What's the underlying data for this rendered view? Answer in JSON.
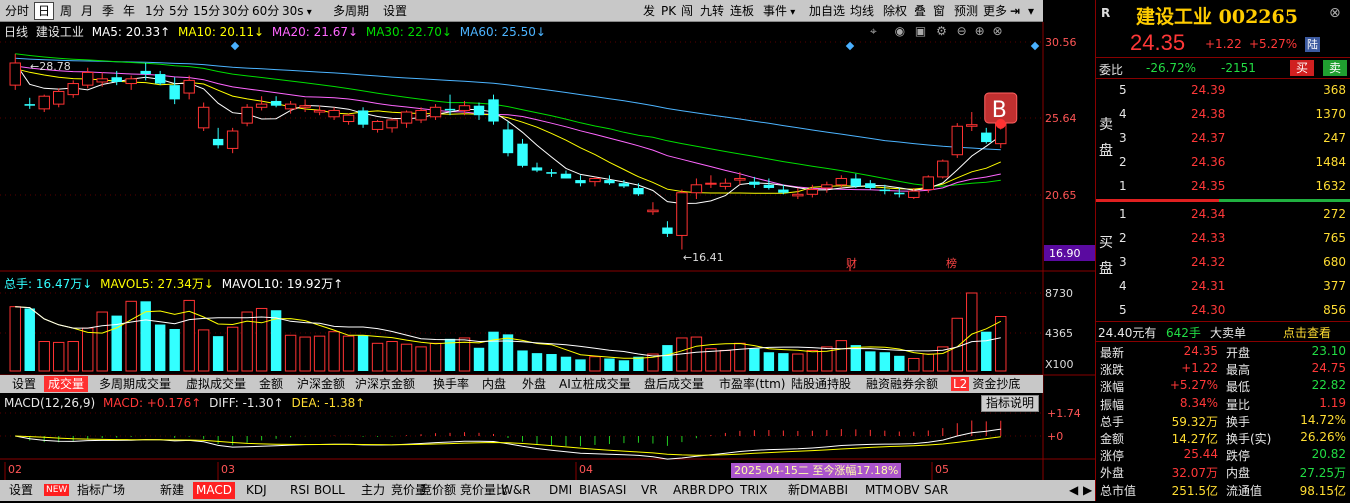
{
  "toolbar": {
    "items": [
      "分时",
      "日",
      "周",
      "月",
      "季",
      "年",
      "1分",
      "5分",
      "15分",
      "30分",
      "60分",
      "30s",
      "多周期",
      "设置"
    ],
    "right": [
      "发",
      "PK",
      "闯",
      "九转",
      "连板",
      "事件",
      "加自选",
      "均线",
      "除权",
      "叠",
      "窗",
      "预测",
      "更多"
    ]
  },
  "price_chart": {
    "label": "日线",
    "name": "建设工业",
    "ma5": "MA5: 20.33↑",
    "ma10": "MA10: 20.11↓",
    "ma20": "MA20: 21.67↓",
    "ma30": "MA30: 22.70↓",
    "ma60": "MA60: 25.50↓",
    "y_ticks": [
      "30.56",
      "25.64",
      "20.65"
    ],
    "low_price_tag": "16.90",
    "hi_label": "28.78",
    "lo_label": "16.41",
    "event_cai": "财",
    "event_bang": "榜",
    "b_marker": "B",
    "colors": {
      "ma5": "#ffffff",
      "ma10": "#ffff00",
      "ma20": "#ff66ff",
      "ma30": "#00dd00",
      "ma60": "#4cb4ff",
      "up": "#ff3333",
      "down": "#33ffff"
    }
  },
  "volume": {
    "label": "总手: 16.47万↓",
    "mavol5": "MAVOL5: 27.34万↓",
    "mavol10": "MAVOL10: 19.92万↑",
    "y_ticks": [
      "8730",
      "4365"
    ],
    "unit": "X100"
  },
  "tabs": [
    "设置",
    "成交量",
    "多周期成交量",
    "虚拟成交量",
    "金额",
    "沪深金额",
    "沪深京金额",
    "换手率",
    "内盘",
    "外盘",
    "AI立桩成交量",
    "盘后成交量",
    "市盈率(ttm)",
    "陆股通持股",
    "融资融券余额",
    "资金抄底"
  ],
  "tab_badge": "L2",
  "macd": {
    "label": "MACD(12,26,9)",
    "macd": "MACD: +0.176↑",
    "diff": "DIFF: -1.30↑",
    "dea": "DEA: -1.38↑",
    "y_ticks": [
      "+1.74",
      "+0"
    ],
    "button": "指标说明"
  },
  "x_axis": {
    "labels": [
      "02",
      "03",
      "04",
      "05"
    ],
    "highlight": "2025-04-15二 至今涨幅17.18%"
  },
  "bottombar": [
    "设置",
    "NEW",
    "指标广场",
    "新建",
    "MACD",
    "KDJ",
    "RSI",
    "BOLL",
    "主力",
    "竞价量",
    "竞价额",
    "竞价量比",
    "W&R",
    "DMI",
    "BIAS",
    "ASI",
    "VR",
    "ARBR",
    "DPO",
    "TRIX",
    "新DMA",
    "BBI",
    "MTM",
    "OBV",
    "SAR"
  ],
  "quote": {
    "r": "R",
    "name": "建设工业",
    "code": "002265",
    "price": "24.35",
    "change": "+1.22",
    "pct": "+5.27%",
    "tag": "陆",
    "weibi_label": "委比",
    "weibi": "-26.72%",
    "weicha": "-2151",
    "buy_btn": "买",
    "sell_btn": "卖",
    "ask_label": [
      "卖",
      "盘"
    ],
    "bid_label": [
      "买",
      "盘"
    ],
    "asks": [
      [
        "5",
        "24.39",
        "368"
      ],
      [
        "4",
        "24.38",
        "1370"
      ],
      [
        "3",
        "24.37",
        "247"
      ],
      [
        "2",
        "24.36",
        "1484"
      ],
      [
        "1",
        "24.35",
        "1632"
      ]
    ],
    "bids": [
      [
        "1",
        "24.34",
        "272"
      ],
      [
        "2",
        "24.33",
        "765"
      ],
      [
        "3",
        "24.32",
        "680"
      ],
      [
        "4",
        "24.31",
        "377"
      ],
      [
        "5",
        "24.30",
        "856"
      ]
    ],
    "bigorder": {
      "price": "24.40元有",
      "qty": "642手",
      "text": "大卖单",
      "link": "点击查看"
    },
    "stats": [
      [
        "最新",
        "24.35",
        "开盘",
        "23.10"
      ],
      [
        "涨跌",
        "+1.22",
        "最高",
        "24.75"
      ],
      [
        "涨幅",
        "+5.27%",
        "最低",
        "22.82"
      ],
      [
        "振幅",
        "8.34%",
        "量比",
        "1.19"
      ],
      [
        "总手",
        "59.32万",
        "换手",
        "14.72%"
      ],
      [
        "金额",
        "14.27亿",
        "换手(实)",
        "26.26%"
      ],
      [
        "涨停",
        "25.44",
        "跌停",
        "20.82"
      ],
      [
        "外盘",
        "32.07万",
        "内盘",
        "27.25万"
      ],
      [
        "总市值",
        "251.5亿",
        "流通值",
        "98.15亿"
      ]
    ]
  },
  "chart_data": {
    "type": "candlestick",
    "ylim": [
      16.41,
      30.56
    ],
    "ohlc": [
      [
        26.8,
        28.78,
        26.5,
        28.2
      ],
      [
        25.6,
        26.0,
        25.3,
        25.5
      ],
      [
        25.3,
        26.2,
        25.1,
        26.1
      ],
      [
        25.6,
        26.6,
        25.4,
        26.4
      ],
      [
        26.2,
        27.1,
        26.0,
        26.9
      ],
      [
        26.8,
        27.9,
        26.6,
        27.6
      ],
      [
        27.0,
        27.6,
        26.7,
        27.2
      ],
      [
        27.3,
        27.7,
        26.8,
        27.0
      ],
      [
        26.9,
        27.4,
        26.5,
        27.2
      ],
      [
        27.7,
        28.2,
        27.1,
        27.5
      ],
      [
        27.5,
        27.7,
        26.8,
        26.9
      ],
      [
        26.8,
        27.3,
        25.6,
        25.9
      ],
      [
        26.3,
        27.4,
        25.9,
        27.1
      ],
      [
        24.1,
        25.7,
        23.9,
        25.4
      ],
      [
        23.4,
        24.1,
        22.8,
        23.0
      ],
      [
        22.8,
        24.1,
        22.5,
        23.9
      ],
      [
        24.4,
        25.6,
        24.2,
        25.4
      ],
      [
        25.4,
        26.1,
        25.2,
        25.6
      ],
      [
        25.8,
        26.1,
        25.4,
        25.5
      ],
      [
        25.3,
        25.8,
        25.0,
        25.6
      ],
      [
        25.4,
        25.9,
        25.1,
        25.5
      ],
      [
        25.1,
        25.5,
        24.9,
        25.2
      ],
      [
        24.8,
        25.4,
        24.6,
        25.2
      ],
      [
        24.5,
        25.0,
        24.3,
        24.9
      ],
      [
        25.2,
        25.4,
        24.1,
        24.3
      ],
      [
        24.0,
        24.6,
        23.8,
        24.5
      ],
      [
        24.1,
        24.7,
        23.8,
        24.6
      ],
      [
        24.4,
        25.2,
        24.1,
        25.1
      ],
      [
        24.6,
        25.4,
        24.4,
        25.2
      ],
      [
        24.8,
        25.6,
        24.6,
        25.4
      ],
      [
        25.3,
        26.2,
        24.9,
        25.2
      ],
      [
        25.2,
        25.8,
        24.9,
        25.5
      ],
      [
        25.5,
        25.7,
        24.6,
        24.9
      ],
      [
        25.9,
        26.2,
        24.3,
        24.5
      ],
      [
        24.0,
        24.5,
        22.3,
        22.5
      ],
      [
        23.1,
        23.4,
        21.6,
        21.7
      ],
      [
        21.6,
        21.9,
        21.3,
        21.4
      ],
      [
        21.3,
        21.5,
        21.0,
        21.2
      ],
      [
        21.2,
        21.4,
        20.9,
        20.9
      ],
      [
        20.8,
        21.1,
        20.4,
        20.6
      ],
      [
        20.7,
        21.0,
        20.4,
        20.9
      ],
      [
        20.8,
        21.1,
        20.5,
        20.6
      ],
      [
        20.6,
        20.8,
        20.3,
        20.4
      ],
      [
        20.3,
        20.6,
        19.8,
        19.9
      ],
      [
        18.8,
        19.4,
        18.6,
        18.9
      ],
      [
        17.8,
        18.2,
        17.2,
        17.4
      ],
      [
        17.3,
        20.2,
        16.41,
        20.0
      ],
      [
        20.0,
        20.9,
        19.6,
        20.5
      ],
      [
        20.6,
        21.1,
        20.3,
        20.6
      ],
      [
        20.4,
        20.9,
        20.2,
        20.6
      ],
      [
        20.8,
        21.3,
        20.5,
        20.9
      ],
      [
        20.7,
        21.0,
        20.3,
        20.5
      ],
      [
        20.5,
        20.9,
        20.2,
        20.3
      ],
      [
        20.2,
        20.5,
        19.9,
        20.0
      ],
      [
        19.8,
        20.3,
        19.6,
        19.9
      ],
      [
        19.9,
        20.5,
        19.7,
        20.2
      ],
      [
        20.3,
        20.7,
        20.0,
        20.5
      ],
      [
        20.5,
        21.1,
        20.3,
        20.9
      ],
      [
        20.9,
        21.2,
        20.3,
        20.4
      ],
      [
        20.6,
        20.8,
        20.2,
        20.3
      ],
      [
        20.2,
        20.5,
        19.9,
        20.1
      ],
      [
        20.0,
        20.3,
        19.7,
        19.9
      ],
      [
        19.7,
        20.3,
        19.6,
        20.1
      ],
      [
        20.2,
        21.1,
        20.0,
        21.0
      ],
      [
        21.0,
        22.1,
        20.9,
        22.0
      ],
      [
        22.4,
        24.4,
        22.2,
        24.2
      ],
      [
        24.2,
        25.1,
        23.9,
        24.3
      ],
      [
        23.8,
        24.1,
        23.1,
        23.2
      ],
      [
        23.1,
        24.75,
        22.82,
        24.35
      ]
    ],
    "volume": [
      7200,
      7000,
      3300,
      3200,
      3300,
      4800,
      6600,
      6200,
      7800,
      7800,
      5200,
      4700,
      7900,
      4600,
      3900,
      4900,
      6600,
      7000,
      6800,
      4000,
      3800,
      3900,
      4400,
      3900,
      4000,
      3100,
      3300,
      3000,
      2700,
      3100,
      3600,
      3700,
      2600,
      4400,
      4100,
      2300,
      2000,
      1900,
      1600,
      1300,
      1600,
      1400,
      1200,
      1600,
      1900,
      2900,
      3700,
      3800,
      2500,
      2300,
      3100,
      2500,
      2100,
      2000,
      1900,
      2300,
      2700,
      3400,
      2900,
      2200,
      2100,
      1700,
      1400,
      1900,
      2700,
      5900,
      8730,
      4400,
      6100
    ]
  }
}
